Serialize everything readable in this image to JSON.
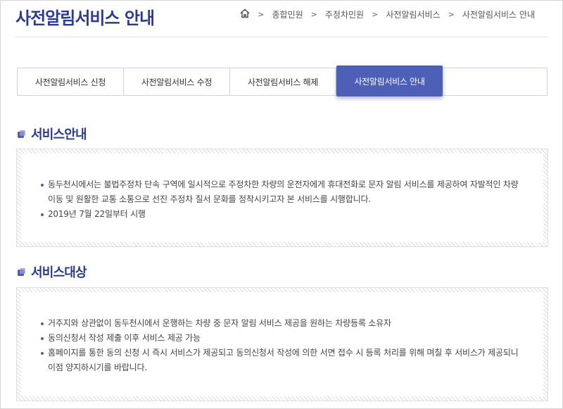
{
  "header": {
    "title": "사전알림서비스 안내",
    "breadcrumb": [
      "종합민원",
      "주정차민원",
      "사전알림서비스",
      "사전알림서비스 안내"
    ]
  },
  "tabs": [
    {
      "label": "사전알림서비스 신청",
      "active": false
    },
    {
      "label": "사전알림서비스 수정",
      "active": false
    },
    {
      "label": "사전알림서비스 해제",
      "active": false
    },
    {
      "label": "사전알림서비스 안내",
      "active": true
    }
  ],
  "sections": [
    {
      "title": "서비스안내",
      "items": [
        "동두천시에서는 불법주정차 단속 구역에 일시적으로 주정차한 차량의 운전자에게 휴대전화로 문자 알림 서비스를 제공하여 자발적인 차량 이동 및 원활한 교통 소통으로 선진 주정차 질서 문화를 정착시키고자 본 서비스를 시행합니다.",
        "2019년 7월 22일부터 시행"
      ]
    },
    {
      "title": "서비스대상",
      "items": [
        "거주지와 상관없이 동두천시에서 운행하는 차량 중 문자 알림 서비스 제공을 원하는 차량등록 소유자",
        "동의신청서 작성 제출 이후 서비스 제공 가능",
        "홈페이지를 통한 동의 신청 시 즉시 서비스가 제공되고 동의신청서 작성에 의한 서면 접수 시 등록 처리를 위해 며칠 후 서비스가 제공되니 이점 양지하시기를 바랍니다."
      ]
    }
  ],
  "colors": {
    "accent": "#4d5fb6",
    "title": "#2c3a8f"
  }
}
